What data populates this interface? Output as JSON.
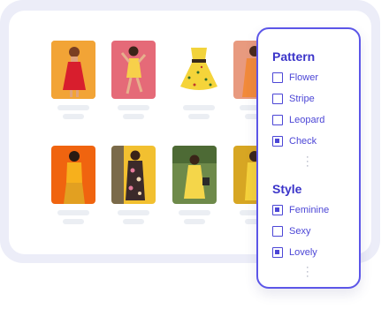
{
  "filters": {
    "pattern": {
      "title": "Pattern",
      "options": [
        {
          "label": "Flower",
          "checked": false
        },
        {
          "label": "Stripe",
          "checked": false
        },
        {
          "label": "Leopard",
          "checked": false
        },
        {
          "label": "Check",
          "checked": true
        }
      ]
    },
    "style": {
      "title": "Style",
      "options": [
        {
          "label": "Feminine",
          "checked": true
        },
        {
          "label": "Sexy",
          "checked": false
        },
        {
          "label": "Lovely",
          "checked": true
        }
      ]
    },
    "more_icon": "vertical-ellipsis-icon"
  },
  "products": [
    {
      "name": "red-dress-on-orange"
    },
    {
      "name": "yellow-dress-on-pink"
    },
    {
      "name": "yellow-floral-dress-flatlay"
    },
    {
      "name": "orange-dress-partial"
    },
    {
      "name": "yellow-outfit-on-orange"
    },
    {
      "name": "floral-outfit-on-yellow"
    },
    {
      "name": "yellow-dress-in-garden"
    },
    {
      "name": "yellow-outfit-partial"
    }
  ],
  "colors": {
    "accent": "#5c56e8",
    "accent_text": "#3b34c9",
    "frame": "#ecedf8",
    "placeholder": "#ebeef3"
  }
}
